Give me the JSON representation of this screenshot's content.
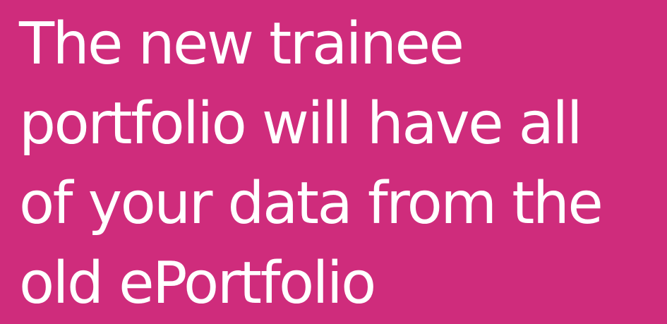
{
  "colors": {
    "background": "#CF2C7C",
    "text": "#FFFFFF"
  },
  "headline": {
    "lines": [
      "The new trainee",
      "portfolio will have all",
      "of your data from the",
      "old ePortfolio"
    ]
  }
}
